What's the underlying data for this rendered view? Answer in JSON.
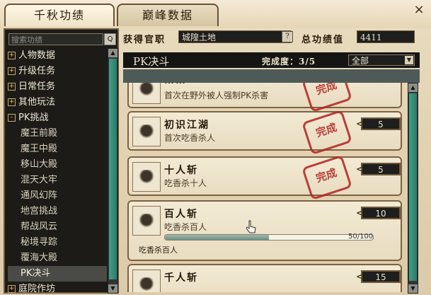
{
  "tabs": [
    {
      "label": "千秋功绩",
      "active": true
    },
    {
      "label": "巅峰数据",
      "active": false
    }
  ],
  "close_label": "×",
  "search": {
    "placeholder": "搜索功绩",
    "button_label": "Q"
  },
  "tree": {
    "groups": [
      {
        "label": "人物数据",
        "toggle": "+"
      },
      {
        "label": "升级任务",
        "toggle": "+"
      },
      {
        "label": "日常任务",
        "toggle": "+"
      },
      {
        "label": "其他玩法",
        "toggle": "+"
      },
      {
        "label": "PK挑战",
        "toggle": "-"
      }
    ],
    "pk_children": [
      "魔王前殿",
      "魔王中殿",
      "移山大殿",
      "混天大牢",
      "通风幻阵",
      "地宫挑战",
      "帮战风云",
      "秘境寻踪",
      "覆海大殿",
      "PK决斗"
    ],
    "selected_child": "PK决斗",
    "after_group": {
      "label": "庭院作坊",
      "toggle": "+"
    }
  },
  "header": {
    "rank_label": "获得官职",
    "rank_value": "城隍土地",
    "rank_help": "?",
    "total_label": "总功绩值",
    "total_value": "4411"
  },
  "category": {
    "title": "PK决斗",
    "progress": "完成度：3/5",
    "filter_value": "全部"
  },
  "achievements": [
    {
      "name": "……",
      "desc": "首次在野外被人强制PK杀害",
      "count": "",
      "completed": true,
      "seal": "完成"
    },
    {
      "name": "初识江湖",
      "desc": "首次吃香杀人",
      "count": "5",
      "completed": true,
      "seal": "完成"
    },
    {
      "name": "十人斩",
      "desc": "吃香杀十人",
      "count": "5",
      "completed": true,
      "seal": "完成"
    },
    {
      "name": "百人斩",
      "desc": "吃香杀百人",
      "count": "10",
      "completed": false,
      "progress": 0.5,
      "progress_text": "50/100",
      "label": "吃香杀百人"
    },
    {
      "name": "千人斩",
      "desc": "",
      "count": "15",
      "completed": false
    }
  ]
}
